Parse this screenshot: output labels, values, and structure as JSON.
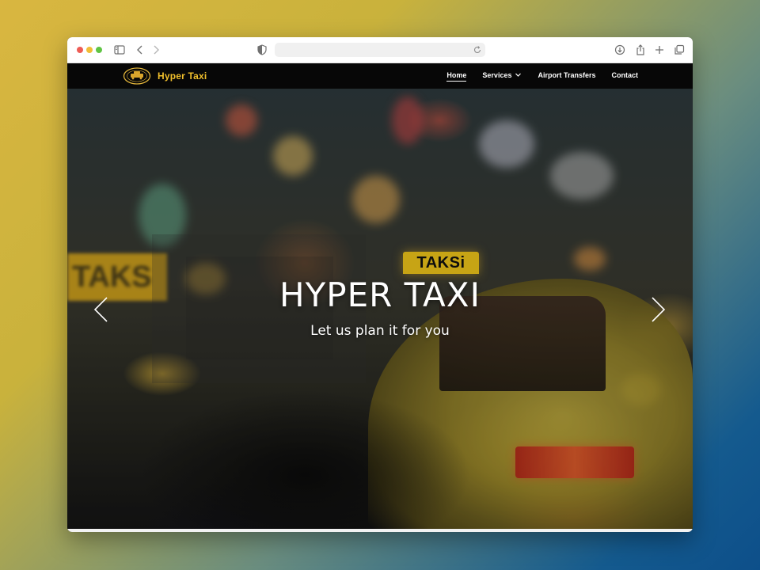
{
  "browser": {
    "address_text": ""
  },
  "site": {
    "brand": "Hyper Taxi",
    "brand_color": "#f0bf2c",
    "nav": {
      "items": [
        {
          "label": "Home",
          "active": true
        },
        {
          "label": "Services",
          "has_dropdown": true
        },
        {
          "label": "Airport Transfers"
        },
        {
          "label": "Contact"
        }
      ]
    }
  },
  "hero": {
    "title": "HYPER TAXI",
    "subtitle": "Let us plan it for you",
    "sign_text": "TAKSi",
    "blurred_sign_text": "TAKS",
    "prev_icon": "chevron-left-icon",
    "next_icon": "chevron-right-icon"
  },
  "chrome_icons": [
    "sidebar-icon",
    "back-icon",
    "forward-icon",
    "shield-icon",
    "reload-icon",
    "download-icon",
    "share-icon",
    "new-tab-icon",
    "tabs-overview-icon"
  ]
}
